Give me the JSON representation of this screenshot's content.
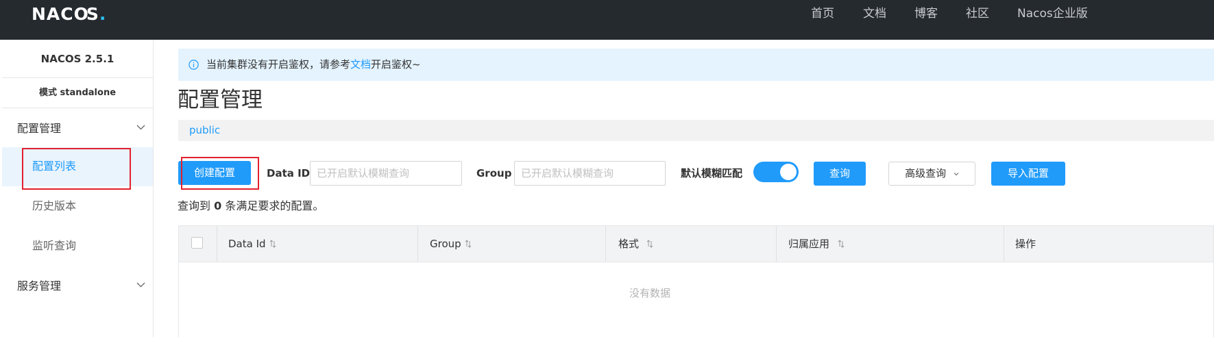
{
  "topbar": {
    "logo": "NACOS",
    "nav": [
      "首页",
      "文档",
      "博客",
      "社区",
      "Nacos企业版"
    ]
  },
  "sidebar": {
    "version": "NACOS 2.5.1",
    "mode": "模式 standalone",
    "groups": [
      {
        "label": "配置管理",
        "items": [
          {
            "label": "配置列表",
            "active": true
          },
          {
            "label": "历史版本",
            "active": false
          },
          {
            "label": "监听查询",
            "active": false
          }
        ]
      },
      {
        "label": "服务管理"
      }
    ]
  },
  "notice": {
    "text_before": "当前集群没有开启鉴权，请参考",
    "link": "文档",
    "text_after": "开启鉴权~"
  },
  "page": {
    "title": "配置管理",
    "namespace": "public"
  },
  "toolbar": {
    "create_label": "创建配置",
    "data_id_label": "Data ID",
    "data_id_placeholder": "已开启默认模糊查询",
    "group_label": "Group",
    "group_placeholder": "已开启默认模糊查询",
    "fuzzy_label": "默认模糊匹配",
    "fuzzy_on": true,
    "query_label": "查询",
    "advanced_label": "高级查询",
    "import_label": "导入配置"
  },
  "result": {
    "prefix": "查询到",
    "count": "0",
    "suffix": "条满足要求的配置。"
  },
  "table": {
    "columns": [
      "Data Id",
      "Group",
      "格式",
      "归属应用",
      "操作"
    ],
    "empty": "没有数据"
  },
  "colors": {
    "topbar": "#252a2f",
    "primary": "#209bfa",
    "notice_bg": "#e4f3fe",
    "active_item_bg": "#eaf4fd",
    "highlight": "#e2202d"
  },
  "icons": [
    "info-icon",
    "chevron-down-icon",
    "sort-icon"
  ]
}
